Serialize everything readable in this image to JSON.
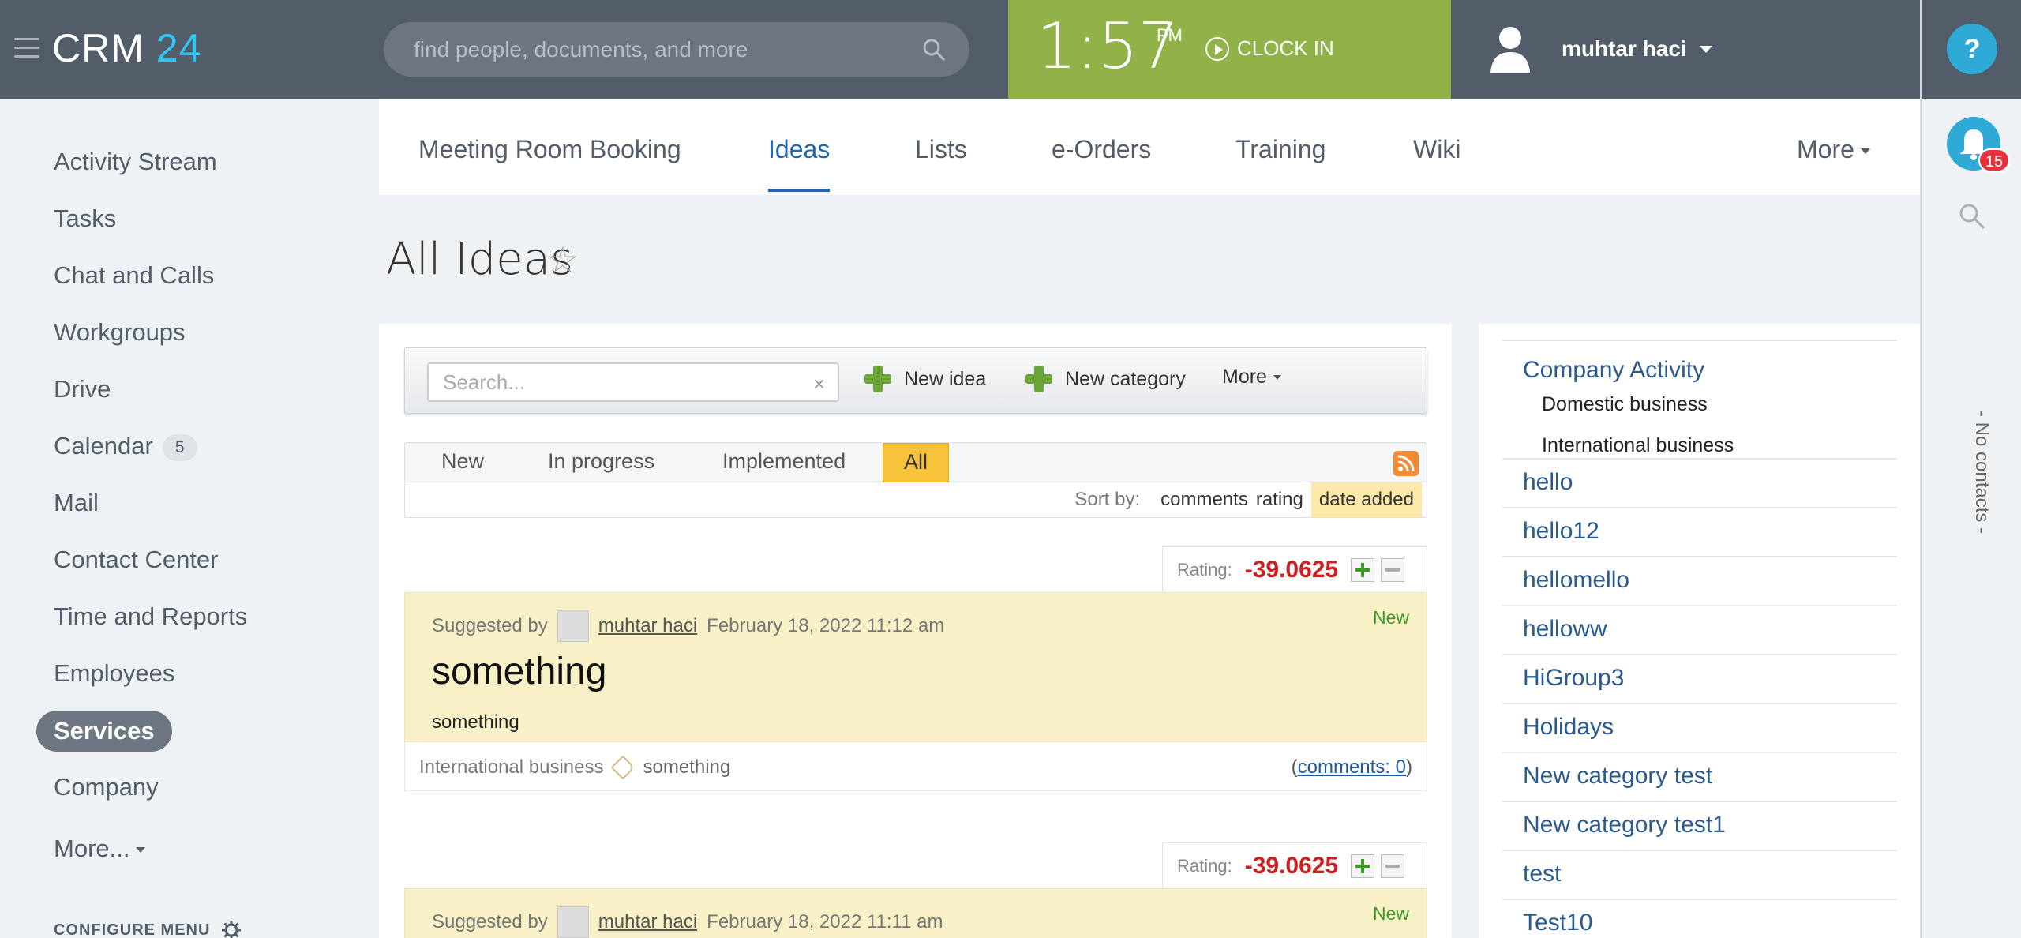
{
  "header": {
    "logo_text": "CRM",
    "logo_num": "24",
    "search_placeholder": "find people, documents, and more",
    "time": "1:57",
    "ampm": "PM",
    "clock_in": "CLOCK IN",
    "user_name": "muhtar haci",
    "help": "?",
    "notifications": "15",
    "no_contacts": "- No contacts -"
  },
  "sidebar": {
    "items": [
      {
        "label": "Activity Stream"
      },
      {
        "label": "Tasks"
      },
      {
        "label": "Chat and Calls"
      },
      {
        "label": "Workgroups"
      },
      {
        "label": "Drive"
      },
      {
        "label": "Calendar",
        "badge": "5"
      },
      {
        "label": "Mail"
      },
      {
        "label": "Contact Center"
      },
      {
        "label": "Time and Reports"
      },
      {
        "label": "Employees"
      },
      {
        "label": "Services"
      },
      {
        "label": "Company"
      },
      {
        "label": "More..."
      }
    ],
    "configure": "CONFIGURE MENU"
  },
  "tabs": [
    "Meeting Room Booking",
    "Ideas",
    "Lists",
    "e-Orders",
    "Training",
    "Wiki",
    "More"
  ],
  "page": {
    "title": "All Ideas",
    "star": "☆"
  },
  "toolbar": {
    "search_placeholder": "Search...",
    "clear": "×",
    "new_idea": "New idea",
    "new_category": "New category",
    "more": "More"
  },
  "filters": {
    "statuses": [
      "New",
      "In progress",
      "Implemented",
      "All"
    ],
    "sort_label": "Sort by:",
    "sort_options": [
      "comments",
      "rating",
      "date added"
    ]
  },
  "ideas": [
    {
      "rating_label": "Rating:",
      "rating": "-39.0625",
      "suggested_by": "Suggested by",
      "author": "muhtar haci",
      "date": "February 18, 2022 11:12 am",
      "status": "New",
      "title": "something",
      "description": "something",
      "category": "International business",
      "tag": "something",
      "comments": "comments: 0"
    },
    {
      "rating_label": "Rating:",
      "rating": "-39.0625",
      "suggested_by": "Suggested by",
      "author": "muhtar haci",
      "date": "February 18, 2022 11:11 am",
      "status": "New"
    }
  ],
  "categories": {
    "top": "Company Activity",
    "subs": [
      "Domestic business",
      "International business"
    ],
    "items": [
      "hello",
      "hello12",
      "hellomello",
      "helloww",
      "HiGroup3",
      "Holidays",
      "New category test",
      "New category test1",
      "test",
      "Test10"
    ]
  },
  "colors": {
    "header_bg": "#535c69",
    "clock_bg": "#90b249",
    "accent_blue": "#2067b0",
    "idea_bg": "#f8f1c7",
    "rating_red": "#cc1f1f"
  }
}
